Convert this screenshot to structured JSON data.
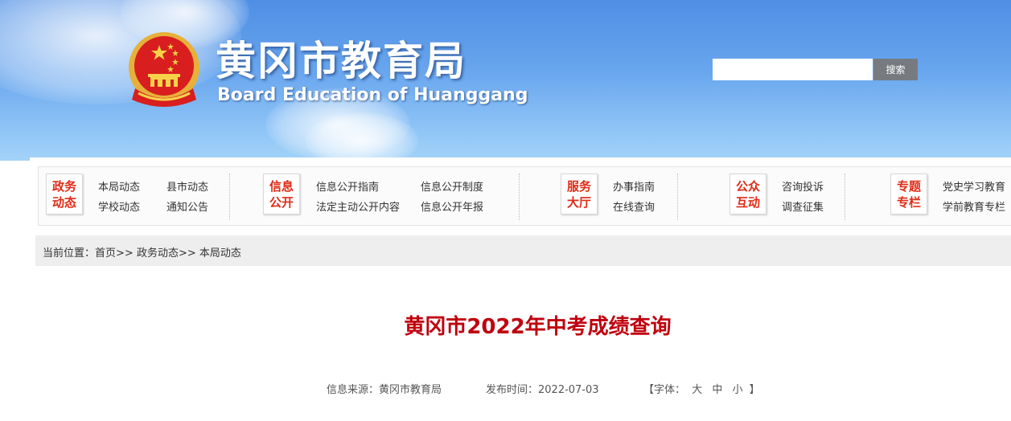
{
  "header": {
    "title": "黄冈市教育局",
    "subtitle": "Board Education of Huanggang",
    "search_placeholder": "",
    "search_button": "搜索"
  },
  "nav": [
    {
      "badge": [
        "政务",
        "动态"
      ],
      "links": [
        "本局动态",
        "县市动态",
        "学校动态",
        "通知公告"
      ]
    },
    {
      "badge": [
        "信息",
        "公开"
      ],
      "links": [
        "信息公开指南",
        "信息公开制度",
        "法定主动公开内容",
        "信息公开年报"
      ]
    },
    {
      "badge": [
        "服务",
        "大厅"
      ],
      "links": [
        "办事指南",
        "在线查询"
      ]
    },
    {
      "badge": [
        "公众",
        "互动"
      ],
      "links": [
        "咨询投诉",
        "调查征集"
      ]
    },
    {
      "badge": [
        "专题",
        "专栏"
      ],
      "links": [
        "党史学习教育",
        "学前教育专栏"
      ]
    }
  ],
  "breadcrumb": {
    "prefix": "当前位置：",
    "items": [
      "首页",
      "政务动态",
      "本局动态"
    ],
    "sep": ">>"
  },
  "article": {
    "title": "黄冈市2022年中考成绩查询",
    "source_label": "信息来源：",
    "source": "黄冈市教育局",
    "date_label": "发布时间：",
    "date": "2022-07-03",
    "font_label": "【字体：",
    "font_sizes": [
      "大",
      "中",
      "小"
    ],
    "font_close": "】"
  },
  "colors": {
    "accent_red": "#c0000e",
    "badge_red": "#e02b17",
    "sky_blue": "#5b9ae8"
  }
}
